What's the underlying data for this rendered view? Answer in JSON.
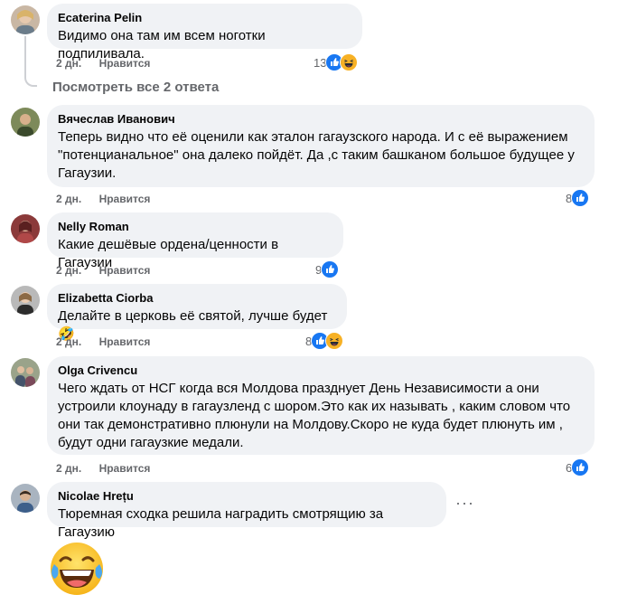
{
  "thread": {
    "view_replies_label": "Посмотреть все 2 ответа",
    "more_label": "···"
  },
  "comments": [
    {
      "author": "Ecaterina Pelin",
      "text": "Видимо она там им всем ноготки подпиливала.",
      "time": "2 дн.",
      "like_label": "Нравится",
      "reaction_count": "13",
      "reactions": [
        "like-icon",
        "haha-icon"
      ]
    },
    {
      "author": "Вячеслав Иванович",
      "text": "Теперь видно что её оценили как эталон гагаузского народа. И с её выражением \"потенцианальное\" она далеко пойдёт. Да ,с таким башканом большое будущее у Гагаузии.",
      "time": "2 дн.",
      "like_label": "Нравится",
      "reaction_count": "8",
      "reactions": [
        "like-icon"
      ]
    },
    {
      "author": "Nelly Roman",
      "text": "Какие дешёвые ордена/ценности в Гагаузии",
      "time": "2 дн.",
      "like_label": "Нравится",
      "reaction_count": "9",
      "reactions": [
        "like-icon"
      ]
    },
    {
      "author": "Elizabetta Ciorba",
      "text": "Делайте в церковь её святой, лучше будет🤣",
      "time": "2 дн.",
      "like_label": "Нравится",
      "reaction_count": "8",
      "reactions": [
        "like-icon",
        "haha-icon"
      ]
    },
    {
      "author": "Olga Crivencu",
      "text": "Чего ждать от НСГ когда вся Молдова празднует День Независимости а они устроили клоунаду в гагаузленд с шором.Это как их называть , каким словом что они так демонстративно плюнули на Молдову.Скоро не куда будет плюнуть им , будут одни гагаузкие медали.",
      "time": "2 дн.",
      "like_label": "Нравится",
      "reaction_count": "6",
      "reactions": [
        "like-icon"
      ]
    },
    {
      "author": "Nicolae Hrețu",
      "text": "Тюремная сходка решила наградить смотрящию за Гагаузию"
    }
  ],
  "colors": {
    "bubble": "#f0f2f5",
    "meta_text": "#65676b",
    "like_blue": "#1877f2",
    "haha_yellow": "#f7b125"
  }
}
